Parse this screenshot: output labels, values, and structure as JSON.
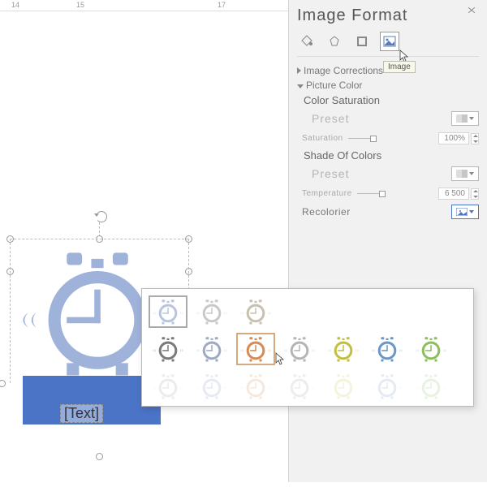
{
  "ruler": {
    "marks": [
      "14",
      "15",
      "17"
    ]
  },
  "panel": {
    "title": "Image Format",
    "sections": {
      "corrections": "Image Corrections",
      "picture_color": "Picture Color",
      "saturation_head": "Color Saturation",
      "preset1": "Preset",
      "saturation_label": "Saturation",
      "saturation_value": "100%",
      "shade_head": "Shade Of Colors",
      "preset2": "Preset",
      "temperature_label": "Temperature",
      "temperature_value": "6 500",
      "recolor": "Recolorier"
    },
    "tooltip": "Image"
  },
  "caption": "[Text]",
  "recolor_swatches": [
    {
      "row": 1,
      "tint": "#b9c5de"
    },
    {
      "row": 1,
      "tint": "#c8c8c8"
    },
    {
      "row": 1,
      "tint": "#c8c0b0"
    },
    {
      "row": 2,
      "tint": "#7a7a7a"
    },
    {
      "row": 2,
      "tint": "#9ea9c4"
    },
    {
      "row": 2,
      "tint": "#d48b55",
      "hover": true
    },
    {
      "row": 2,
      "tint": "#b5b5b5"
    },
    {
      "row": 2,
      "tint": "#c0c040"
    },
    {
      "row": 2,
      "tint": "#6a97c8"
    },
    {
      "row": 2,
      "tint": "#8bbf5c"
    },
    {
      "row": 3,
      "tint": "#dedede"
    },
    {
      "row": 3,
      "tint": "#d3dae8"
    },
    {
      "row": 3,
      "tint": "#edd6c4"
    },
    {
      "row": 3,
      "tint": "#e0e0e0"
    },
    {
      "row": 3,
      "tint": "#ecebc4"
    },
    {
      "row": 3,
      "tint": "#cedbeb"
    },
    {
      "row": 3,
      "tint": "#d7e8c9"
    }
  ]
}
